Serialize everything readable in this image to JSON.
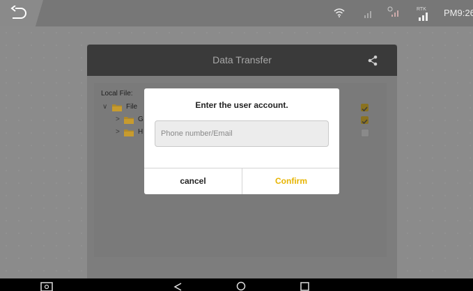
{
  "status_bar": {
    "time": "PM9:26",
    "rtk_label": "RTK",
    "icons": [
      "back-icon",
      "wifi-icon",
      "signal-icon",
      "gps-signal-icon",
      "rtk-signal-icon"
    ]
  },
  "panel": {
    "title": "Data Transfer",
    "local_file_label": "Local File:",
    "tree": [
      {
        "label": "File",
        "checked": true
      },
      {
        "label": "G",
        "checked": true
      },
      {
        "label": "H",
        "checked": false
      }
    ]
  },
  "dialog": {
    "title": "Enter the user account.",
    "input_placeholder": "Phone number/Email",
    "input_value": "",
    "cancel_label": "cancel",
    "confirm_label": "Confirm",
    "accent_color": "#e7b400"
  },
  "nav_bar": {
    "icons": [
      "screenshot-icon",
      "back-triangle-icon",
      "home-circle-icon",
      "recents-square-icon"
    ]
  }
}
